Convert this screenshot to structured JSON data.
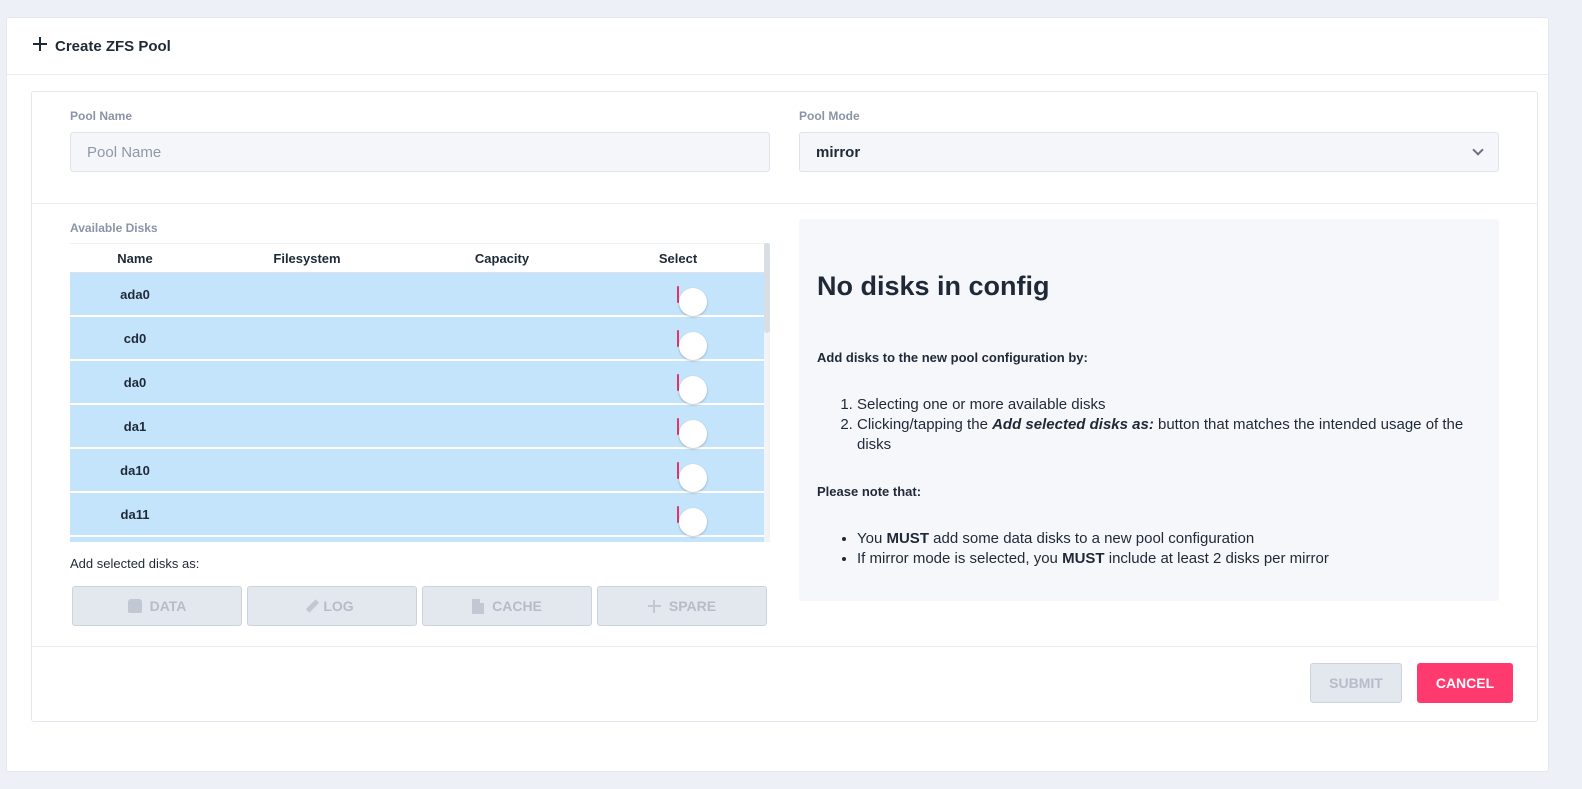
{
  "header": {
    "title": "Create ZFS Pool",
    "icon": "plus-icon"
  },
  "pool_name": {
    "label": "Pool Name",
    "placeholder": "Pool Name",
    "value": ""
  },
  "pool_mode": {
    "label": "Pool Mode",
    "value": "mirror"
  },
  "disks": {
    "label": "Available Disks",
    "columns": [
      "Name",
      "Filesystem",
      "Capacity",
      "Select"
    ],
    "rows": [
      {
        "name": "ada0",
        "filesystem": "",
        "capacity": "",
        "selected": false
      },
      {
        "name": "cd0",
        "filesystem": "",
        "capacity": "",
        "selected": false
      },
      {
        "name": "da0",
        "filesystem": "",
        "capacity": "",
        "selected": false
      },
      {
        "name": "da1",
        "filesystem": "",
        "capacity": "",
        "selected": false
      },
      {
        "name": "da10",
        "filesystem": "",
        "capacity": "",
        "selected": false
      },
      {
        "name": "da11",
        "filesystem": "",
        "capacity": "",
        "selected": false
      }
    ]
  },
  "add_as": {
    "label": "Add selected disks as:",
    "buttons": [
      {
        "label": "DATA",
        "icon": "disk-icon"
      },
      {
        "label": "LOG",
        "icon": "pencil-icon"
      },
      {
        "label": "CACHE",
        "icon": "file-icon"
      },
      {
        "label": "SPARE",
        "icon": "plus-icon"
      }
    ]
  },
  "info": {
    "title": "No disks in config",
    "instructions_heading": "Add disks to the new pool configuration by:",
    "step1": "Selecting one or more available disks",
    "step2_pre": "Clicking/tapping the ",
    "step2_emph": "Add selected disks as:",
    "step2_post": " button that matches the intended usage of the disks",
    "note_heading": "Please note that:",
    "note1_pre": "You ",
    "note1_emph": "MUST",
    "note1_post": " add some data disks to a new pool configuration",
    "note2_pre": "If mirror mode is selected, you ",
    "note2_emph": "MUST",
    "note2_post": " include at least 2 disks per mirror"
  },
  "footer": {
    "submit_label": "SUBMIT",
    "cancel_label": "CANCEL"
  },
  "colors": {
    "accent": "#ff3a6e",
    "row_bg": "#c3e4fb",
    "toggle_border": "#e0356a"
  }
}
